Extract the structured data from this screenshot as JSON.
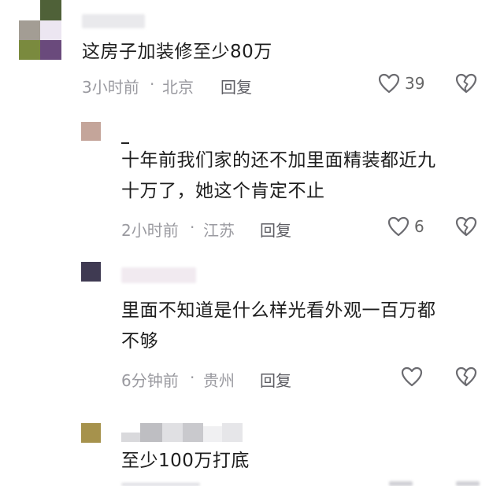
{
  "comments": [
    {
      "text": "这房子加装修至少80万",
      "time": "3小时前",
      "location": "北京",
      "reply_label": "回复",
      "likes": "39",
      "avatar_colors": [
        "#5a6a3f",
        "#a9a399",
        "#e8e1ee",
        "#8a7b86",
        "#7d8a43",
        "#6e4d7e"
      ]
    },
    {
      "text_lines": [
        "十年前我们家的还不加里面精装都近九",
        "十万了，她这个肯定不止"
      ],
      "time": "2小时前",
      "location": "江苏",
      "reply_label": "回复",
      "likes": "6",
      "avatar_color": "#c4a59a"
    },
    {
      "text_lines": [
        "里面不知道是什么样光看外观一百万都",
        "不够"
      ],
      "time": "6分钟前",
      "location": "贵州",
      "reply_label": "回复",
      "likes": "",
      "avatar_color": "#3f3a52"
    },
    {
      "text": "至少100万打底",
      "avatar_color": "#a6924c"
    }
  ],
  "icons": {
    "like": "heart-outline-icon",
    "dislike": "broken-heart-icon"
  },
  "colors": {
    "meta": "#9a9aa0",
    "reply": "#5d5d63",
    "icon": "#6b6b70"
  }
}
